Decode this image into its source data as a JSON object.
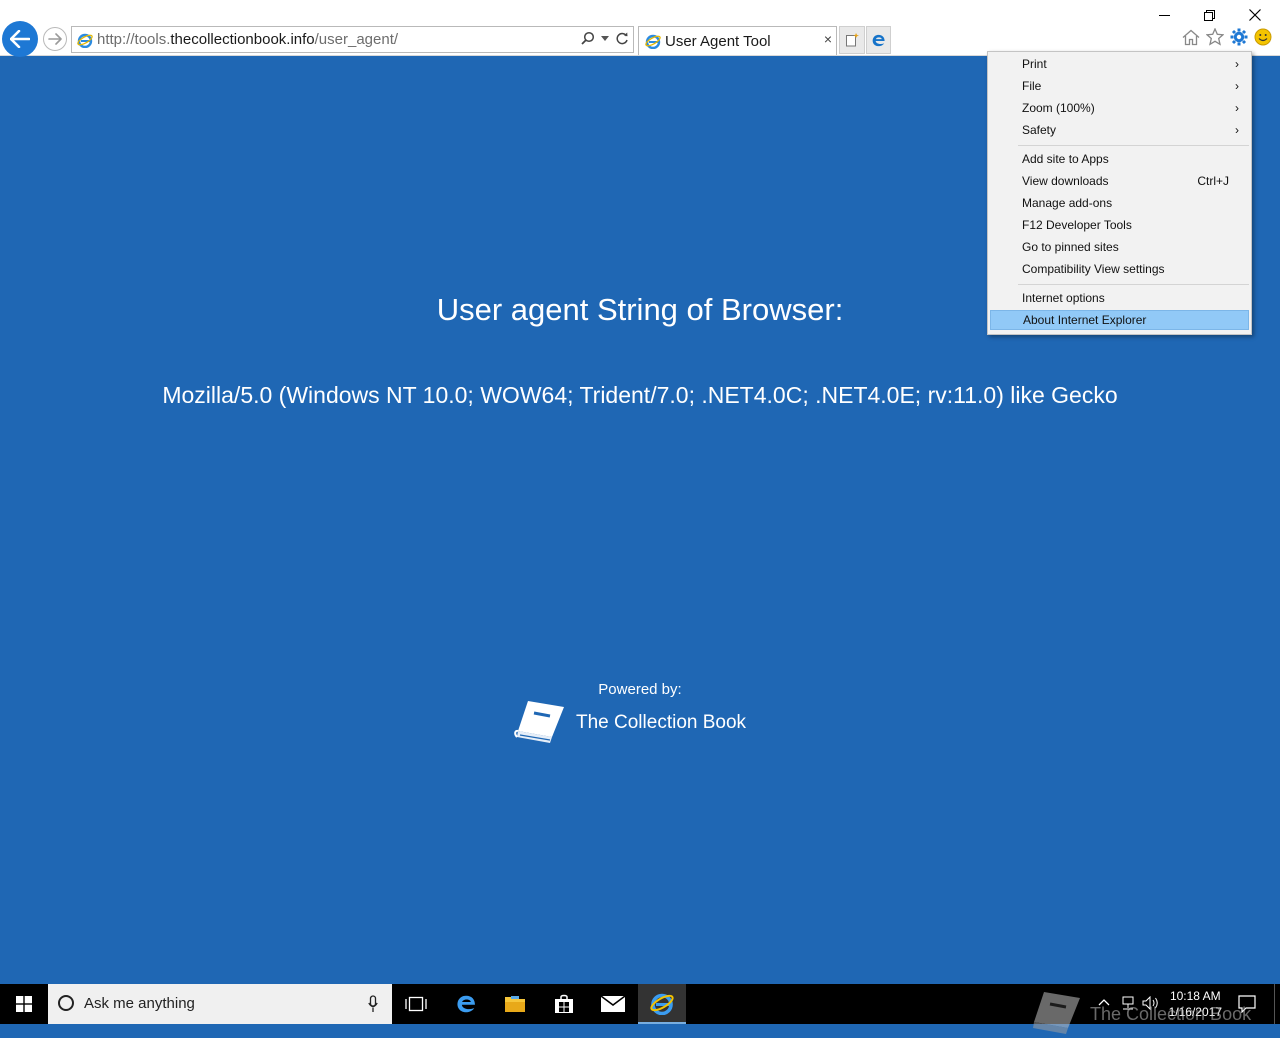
{
  "browser": {
    "url_prefix": "http://tools.",
    "url_domain": "thecollectionbook.info",
    "url_path": "/user_agent/",
    "tab_title": "User Agent Tool",
    "tab_close": "×"
  },
  "page": {
    "heading": "User agent String of Browser:",
    "ua_string": "Mozilla/5.0 (Windows NT 10.0; WOW64; Trident/7.0; .NET4.0C; .NET4.0E; rv:11.0) like Gecko",
    "powered_by": "Powered by:",
    "brand_name": "The Collection Book"
  },
  "menu": {
    "items": [
      {
        "label": "Print",
        "arrow": "›"
      },
      {
        "label": "File",
        "arrow": "›"
      },
      {
        "label": "Zoom (100%)",
        "arrow": "›"
      },
      {
        "label": "Safety",
        "arrow": "›"
      },
      {
        "label": "Add site to Apps"
      },
      {
        "label": "View downloads",
        "shortcut": "Ctrl+J"
      },
      {
        "label": "Manage add-ons"
      },
      {
        "label": "F12 Developer Tools"
      },
      {
        "label": "Go to pinned sites"
      },
      {
        "label": "Compatibility View settings"
      },
      {
        "label": "Internet options"
      },
      {
        "label": "About Internet Explorer"
      }
    ]
  },
  "taskbar": {
    "search_placeholder": "Ask me anything",
    "time": "10:18 AM",
    "date": "1/16/2017"
  },
  "watermark": {
    "text": "The Collection Book"
  },
  "colors": {
    "page_bg": "#1f67b4",
    "menu_highlight": "#91c9f7",
    "ie_blue": "#1e78d4"
  }
}
